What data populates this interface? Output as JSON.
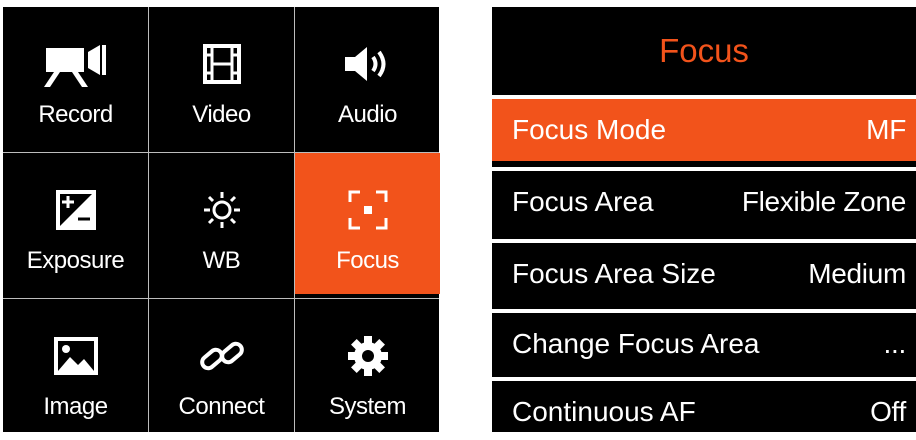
{
  "menu": {
    "items": [
      {
        "label": "Record",
        "icon": "video-camera-icon"
      },
      {
        "label": "Video",
        "icon": "film-strip-icon"
      },
      {
        "label": "Audio",
        "icon": "speaker-icon"
      },
      {
        "label": "Exposure",
        "icon": "exposure-compensation-icon"
      },
      {
        "label": "WB",
        "icon": "sun-icon"
      },
      {
        "label": "Focus",
        "icon": "focus-frame-icon",
        "active": true
      },
      {
        "label": "Image",
        "icon": "image-icon"
      },
      {
        "label": "Connect",
        "icon": "link-icon"
      },
      {
        "label": "System",
        "icon": "gear-icon"
      }
    ]
  },
  "panel": {
    "title": "Focus",
    "rows": [
      {
        "label": "Focus Mode",
        "value": "MF",
        "selected": true
      },
      {
        "label": "Focus Area",
        "value": "Flexible Zone"
      },
      {
        "label": "Focus Area Size",
        "value": "Medium"
      },
      {
        "label": "Change Focus Area",
        "value": "..."
      },
      {
        "label": "Continuous AF",
        "value": "Off"
      }
    ]
  },
  "colors": {
    "accent": "#f2531b",
    "background": "#000000",
    "text": "#ffffff",
    "divider": "#bdbdbd"
  }
}
